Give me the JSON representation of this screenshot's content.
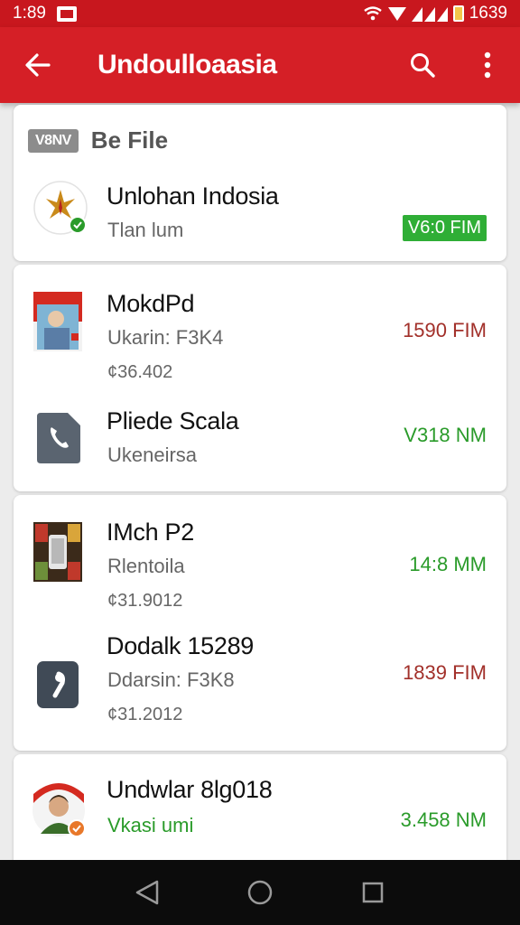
{
  "status_bar": {
    "time": "1:89",
    "battery_text": "1639"
  },
  "app_bar": {
    "title": "Undoulloaasia"
  },
  "section": {
    "badge": "V8NV",
    "title": "Be File"
  },
  "items": [
    {
      "name": "Unlohan Indosia",
      "sub": "Tlan lum",
      "extra": "",
      "amount": "V6:0 FIM"
    },
    {
      "name": "MokdPd",
      "sub": "Ukarin: F3K4",
      "extra": "¢36.402",
      "amount": "1590 FIM"
    },
    {
      "name": "Pliede Scala",
      "sub": "Ukeneirsa",
      "extra": "",
      "amount": "V318 NM"
    },
    {
      "name": "IMch P2",
      "sub": "Rlentoila",
      "extra": "¢31.9012",
      "amount": "14:8 MM"
    },
    {
      "name": "Dodalk 15289",
      "sub": "Ddarsin: F3K8",
      "extra": "¢31.2012",
      "amount": "1839 FIM"
    },
    {
      "name": "Undwlar 8lg018",
      "sub": "Vkasi umi",
      "extra": "",
      "amount": "3.458 NM"
    }
  ],
  "colors": {
    "primary": "#d51f26",
    "status": "#c8171e",
    "green": "#2a9b2a",
    "amount_red": "#a2302a"
  }
}
